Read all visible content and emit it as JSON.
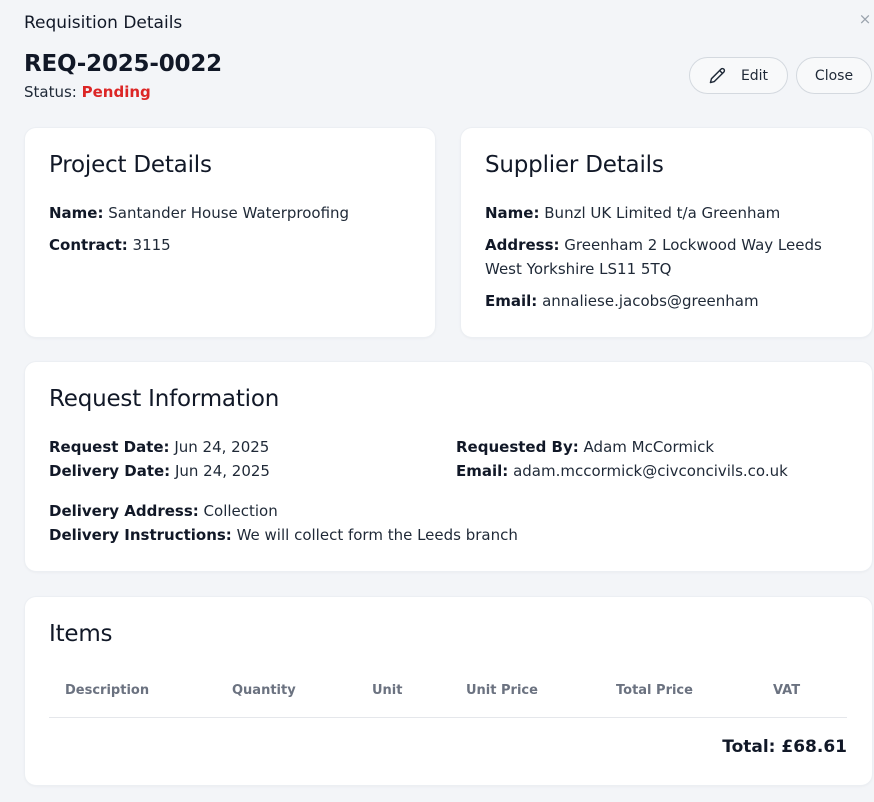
{
  "modal": {
    "title": "Requisition Details",
    "close_symbol": "×"
  },
  "requisition": {
    "id": "REQ-2025-0022",
    "status_label": "Status:",
    "status_value": "Pending",
    "status_color": "#dc2626"
  },
  "actions": {
    "edit_label": "Edit",
    "edit_icon": "pencil-icon",
    "close_label": "Close"
  },
  "project": {
    "heading": "Project Details",
    "name_label": "Name:",
    "name_value": "Santander House Waterproofing",
    "contract_label": "Contract:",
    "contract_value": "3115"
  },
  "supplier": {
    "heading": "Supplier Details",
    "name_label": "Name:",
    "name_value": "Bunzl UK Limited t/a Greenham",
    "address_label": "Address:",
    "address_value": "Greenham 2 Lockwood Way Leeds West Yorkshire LS11 5TQ",
    "email_label": "Email:",
    "email_value": "annaliese.jacobs@greenham"
  },
  "request": {
    "heading": "Request Information",
    "request_date_label": "Request Date:",
    "request_date_value": "Jun 24, 2025",
    "delivery_date_label": "Delivery Date:",
    "delivery_date_value": "Jun 24, 2025",
    "requested_by_label": "Requested By:",
    "requested_by_value": "Adam McCormick",
    "email_label": "Email:",
    "email_value": "adam.mccormick@civconcivils.co.uk",
    "delivery_address_label": "Delivery Address:",
    "delivery_address_value": "Collection",
    "delivery_instructions_label": "Delivery Instructions:",
    "delivery_instructions_value": "We will collect form the Leeds branch"
  },
  "items": {
    "heading": "Items",
    "columns": [
      "Description",
      "Quantity",
      "Unit",
      "Unit Price",
      "Total Price",
      "VAT"
    ],
    "total_text": "Total: £68.61"
  }
}
